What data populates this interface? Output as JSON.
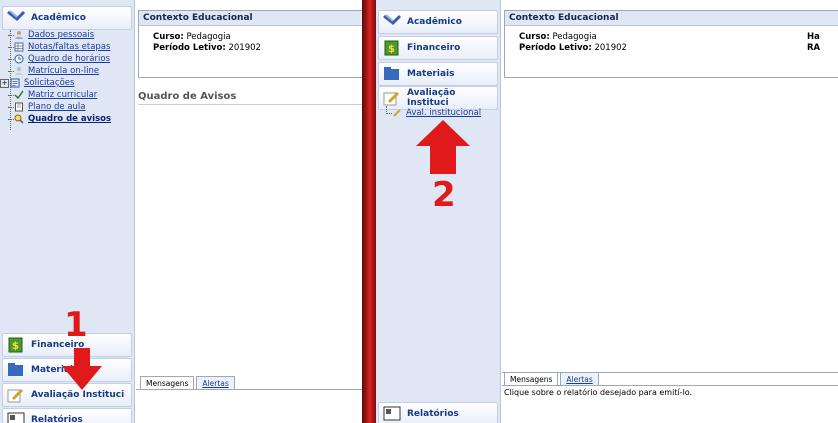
{
  "left": {
    "sidebar": {
      "academico": "Acadêmico",
      "items": [
        {
          "label": "Dados pessoais",
          "icon": "person-icon"
        },
        {
          "label": "Notas/faltas etapas",
          "icon": "table-icon"
        },
        {
          "label": "Quadro de horários",
          "icon": "clock-icon"
        },
        {
          "label": "Matrícula on-line",
          "icon": "person-icon"
        },
        {
          "label": "Solicitações",
          "icon": "form-icon"
        },
        {
          "label": "Matriz curricular",
          "icon": "check-icon"
        },
        {
          "label": "Plano de aula",
          "icon": "book-icon"
        },
        {
          "label": "Quadro de avisos",
          "icon": "notice-icon"
        }
      ],
      "financeiro": "Financeiro",
      "materiais": "Materiais",
      "avaliacao": "Avaliação Instituci",
      "relatorios": "Relatórios"
    },
    "context": {
      "title": "Contexto Educacional",
      "curso_label": "Curso:",
      "curso_value": "Pedagogia",
      "periodo_label": "Período Letivo:",
      "periodo_value": "201902"
    },
    "avisos_title": "Quadro de Avisos",
    "tabs": [
      "Mensagens",
      "Alertas"
    ],
    "annotation_number": "1"
  },
  "right": {
    "sidebar": {
      "academico": "Acadêmico",
      "financeiro": "Financeiro",
      "materiais": "Materiais",
      "avaliacao": "Avaliação Instituci",
      "sub_item": "Aval. institucional",
      "relatorios": "Relatórios"
    },
    "context": {
      "title": "Contexto Educacional",
      "curso_label": "Curso:",
      "curso_value": "Pedagogia",
      "periodo_label": "Período Letivo:",
      "periodo_value": "201902",
      "cut_1": "Ha",
      "cut_2": "RA"
    },
    "tabs": [
      "Mensagens",
      "Alertas"
    ],
    "message": "Clique sobre o relatório desejado para emití-lo.",
    "annotation_number": "2"
  },
  "colors": {
    "sidebar_bg": "#dfe7f5",
    "link": "#1a3c9c",
    "arrow": "#e01a1a",
    "divider": "#b11a1a"
  }
}
